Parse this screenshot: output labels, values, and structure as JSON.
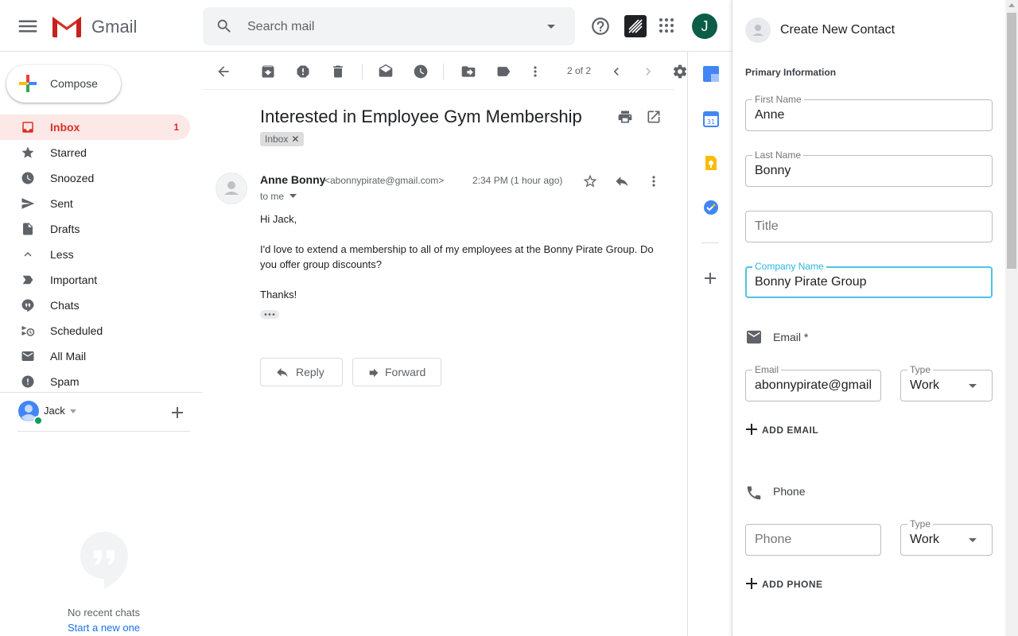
{
  "app": {
    "name": "Gmail",
    "user_initial": "J"
  },
  "search": {
    "placeholder": "Search mail"
  },
  "compose": {
    "label": "Compose"
  },
  "nav": [
    {
      "key": "inbox",
      "label": "Inbox",
      "count": "1",
      "icon": "inbox-icon",
      "active": true
    },
    {
      "key": "starred",
      "label": "Starred",
      "icon": "star-icon"
    },
    {
      "key": "snoozed",
      "label": "Snoozed",
      "icon": "clock-icon"
    },
    {
      "key": "sent",
      "label": "Sent",
      "icon": "send-icon"
    },
    {
      "key": "drafts",
      "label": "Drafts",
      "icon": "draft-icon"
    },
    {
      "key": "less",
      "label": "Less",
      "icon": "chevron-up-icon"
    },
    {
      "key": "important",
      "label": "Important",
      "icon": "important-icon"
    },
    {
      "key": "chats",
      "label": "Chats",
      "icon": "chat-icon"
    },
    {
      "key": "scheduled",
      "label": "Scheduled",
      "icon": "scheduled-icon"
    },
    {
      "key": "all-mail",
      "label": "All Mail",
      "icon": "mail-icon"
    },
    {
      "key": "spam",
      "label": "Spam",
      "icon": "spam-icon"
    }
  ],
  "hangouts": {
    "user_name": "Jack",
    "no_chats": "No recent chats",
    "start_new": "Start a new one"
  },
  "toolbar": {
    "page_count": "2 of 2"
  },
  "email": {
    "subject": "Interested in Employee Gym Membership",
    "label_chip": "Inbox",
    "sender_name": "Anne Bonny",
    "sender_email": "<abonnypirate@gmail.com>",
    "time": "2:34 PM (1 hour ago)",
    "to": "to me",
    "body": [
      "Hi Jack,",
      "I'd love to extend a membership to all of my employees at the Bonny Pirate Group. Do you offer group discounts?",
      "Thanks!"
    ],
    "reply_label": "Reply",
    "forward_label": "Forward"
  },
  "contact_panel": {
    "title": "Create New Contact",
    "section_primary": "Primary Information",
    "first_name": {
      "label": "First Name",
      "value": "Anne"
    },
    "last_name": {
      "label": "Last Name",
      "value": "Bonny"
    },
    "title_field": {
      "placeholder": "Title"
    },
    "company": {
      "label": "Company Name",
      "value": "Bonny Pirate Group"
    },
    "email_section": "Email *",
    "email_field": {
      "label": "Email",
      "value": "abonnypirate@gmail"
    },
    "email_type": {
      "label": "Type",
      "value": "Work"
    },
    "add_email": "ADD EMAIL",
    "phone_section": "Phone",
    "phone_field": {
      "placeholder": "Phone"
    },
    "phone_type": {
      "label": "Type",
      "value": "Work"
    },
    "add_phone": "ADD PHONE"
  },
  "colors": {
    "accent_red": "#d93025",
    "active_bg": "#fce8e6",
    "focus_blue": "#2ab6e0",
    "link_blue": "#1a73e8",
    "avatar_green": "#0b5d48"
  }
}
